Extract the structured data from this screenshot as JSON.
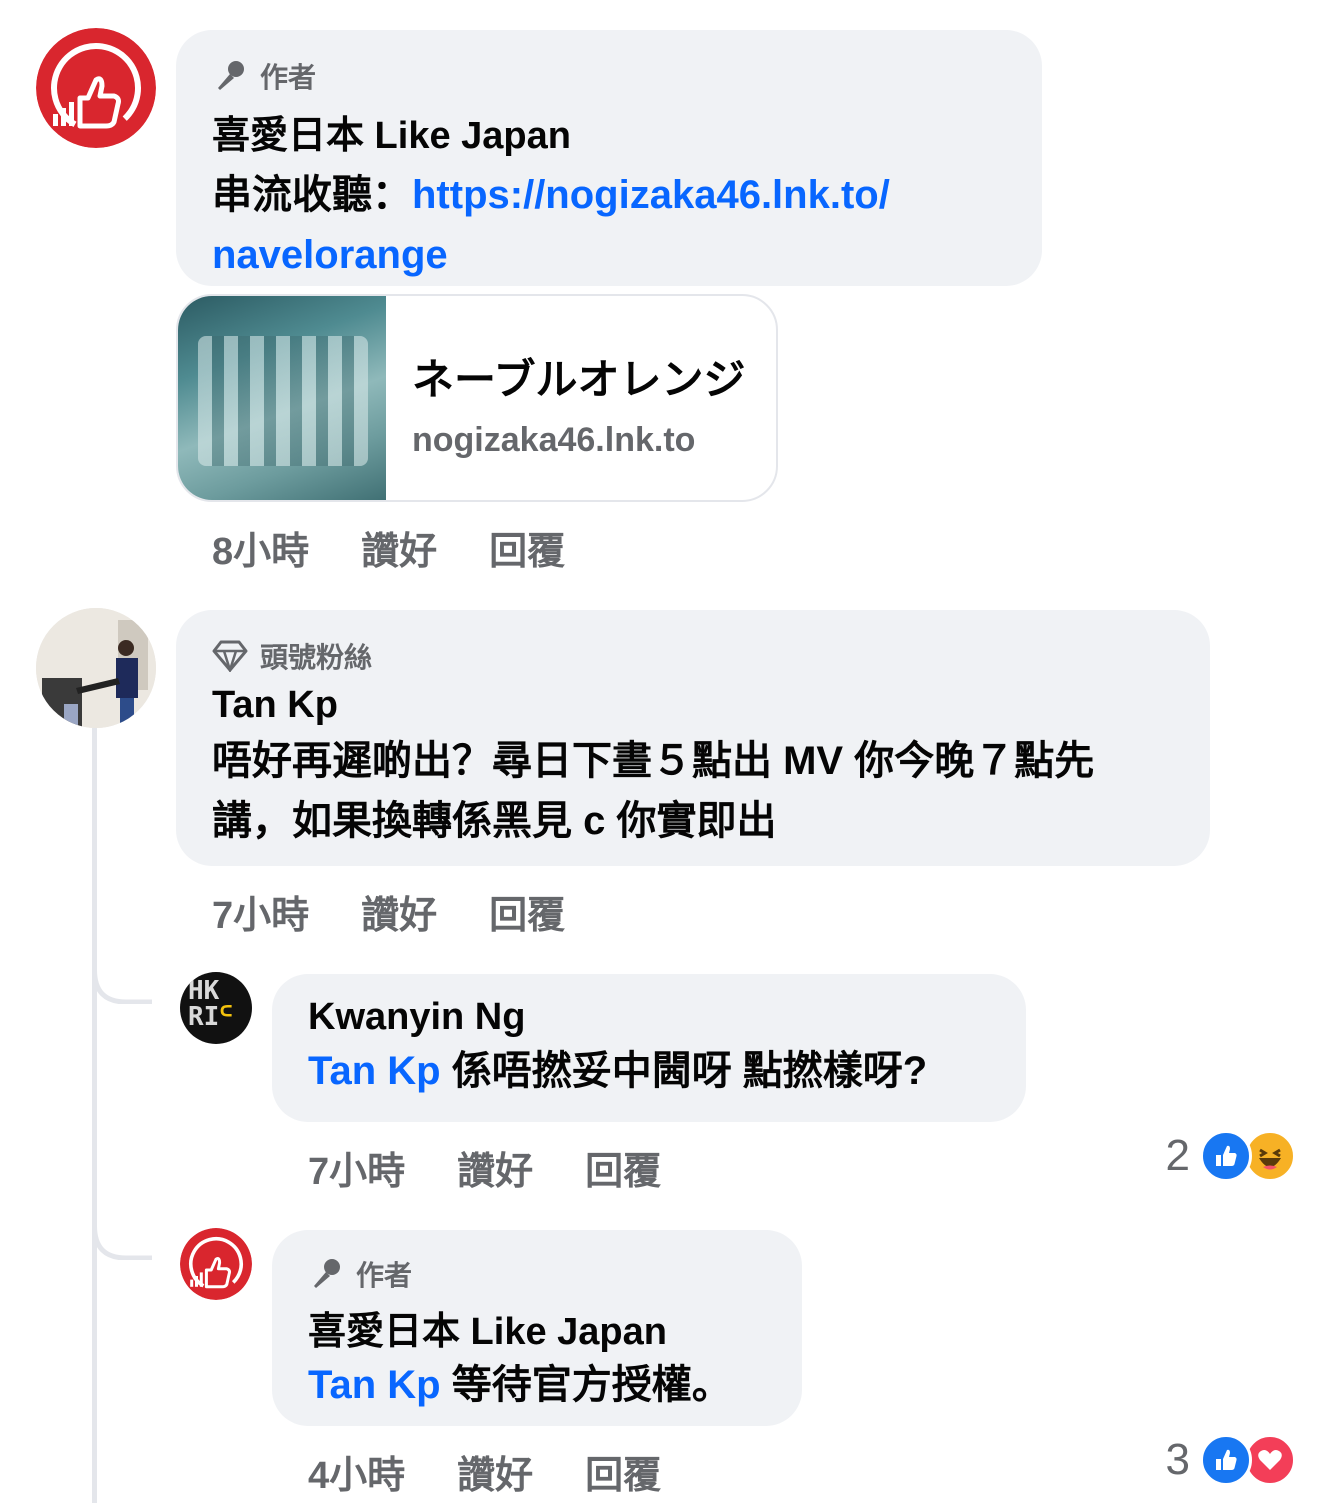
{
  "comments": [
    {
      "badge": "作者",
      "author": "喜愛日本 Like Japan",
      "text_prefix": "串流收聽：",
      "link_line1": "https://nogizaka46.lnk.to/",
      "link_line2": "navelorange",
      "preview": {
        "title": "ネーブルオレンジ",
        "domain": "nogizaka46.lnk.to"
      },
      "time": "8小時",
      "like": "讚好",
      "reply": "回覆"
    },
    {
      "badge": "頭號粉絲",
      "author": "Tan Kp",
      "text_line1": "唔好再遲啲出？尋日下晝５點出 MV 你今晚７點先",
      "text_line2": "講，如果換轉係黑見 c 你實即出",
      "time": "7小時",
      "like": "讚好",
      "reply": "回覆",
      "replies": [
        {
          "author": "Kwanyin Ng",
          "avatar_text_top": "HK",
          "avatar_text_bottom": "RI",
          "mention": "Tan Kp",
          "text": " 係唔撚妥中閪呀 點撚樣呀?",
          "time": "7小時",
          "like": "讚好",
          "reply": "回覆",
          "reaction_count": "2",
          "reaction_icons": [
            "like-icon",
            "haha-icon"
          ]
        },
        {
          "badge": "作者",
          "author": "喜愛日本 Like Japan",
          "mention": "Tan Kp",
          "text": " 等待官方授權。",
          "time": "4小時",
          "like": "讚好",
          "reply": "回覆",
          "reaction_count": "3",
          "reaction_icons": [
            "like-icon",
            "love-icon"
          ]
        }
      ]
    }
  ],
  "colors": {
    "link": "#0866ff",
    "bubble": "#f0f2f5",
    "brand_red": "#d9262e"
  }
}
